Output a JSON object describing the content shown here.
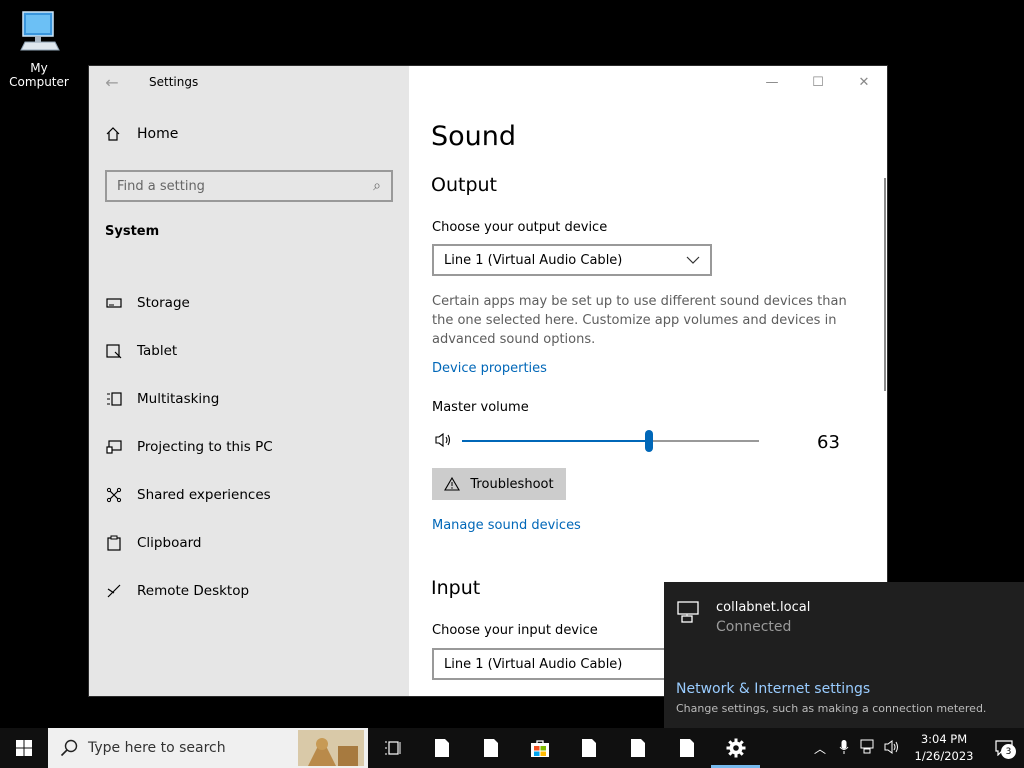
{
  "desktop": {
    "icon_label": "My Computer"
  },
  "window": {
    "app_title": "Settings",
    "nav_home": "Home",
    "search_placeholder": "Find a setting",
    "section": "System",
    "nav_items": [
      {
        "label": "Storage",
        "icon": "storage-icon"
      },
      {
        "label": "Tablet",
        "icon": "tablet-icon"
      },
      {
        "label": "Multitasking",
        "icon": "multitasking-icon"
      },
      {
        "label": "Projecting to this PC",
        "icon": "projecting-icon"
      },
      {
        "label": "Shared experiences",
        "icon": "shared-experiences-icon"
      },
      {
        "label": "Clipboard",
        "icon": "clipboard-icon"
      },
      {
        "label": "Remote Desktop",
        "icon": "remote-desktop-icon"
      }
    ]
  },
  "sound": {
    "title": "Sound",
    "output_heading": "Output",
    "output_label": "Choose your output device",
    "output_device": "Line 1 (Virtual Audio Cable)",
    "output_desc": "Certain apps may be set up to use different sound devices than the one selected here. Customize app volumes and devices in advanced sound options.",
    "device_properties": "Device properties",
    "master_volume_label": "Master volume",
    "master_volume": 63,
    "master_volume_text": "63",
    "troubleshoot": "Troubleshoot",
    "manage_devices": "Manage sound devices",
    "input_heading": "Input",
    "input_label": "Choose your input device",
    "input_device": "Line 1 (Virtual Audio Cable)"
  },
  "network_flyout": {
    "name": "collabnet.local",
    "status": "Connected",
    "settings_link": "Network & Internet settings",
    "settings_hint": "Change settings, such as making a connection metered."
  },
  "taskbar": {
    "search_placeholder": "Type here to search",
    "time": "3:04 PM",
    "date": "1/26/2023",
    "notification_count": "3"
  },
  "colors": {
    "accent": "#0067b8",
    "sidebar_bg": "#e6e6e6",
    "flyout_bg": "#1f1f1f",
    "link_dark": "#99ccff"
  }
}
